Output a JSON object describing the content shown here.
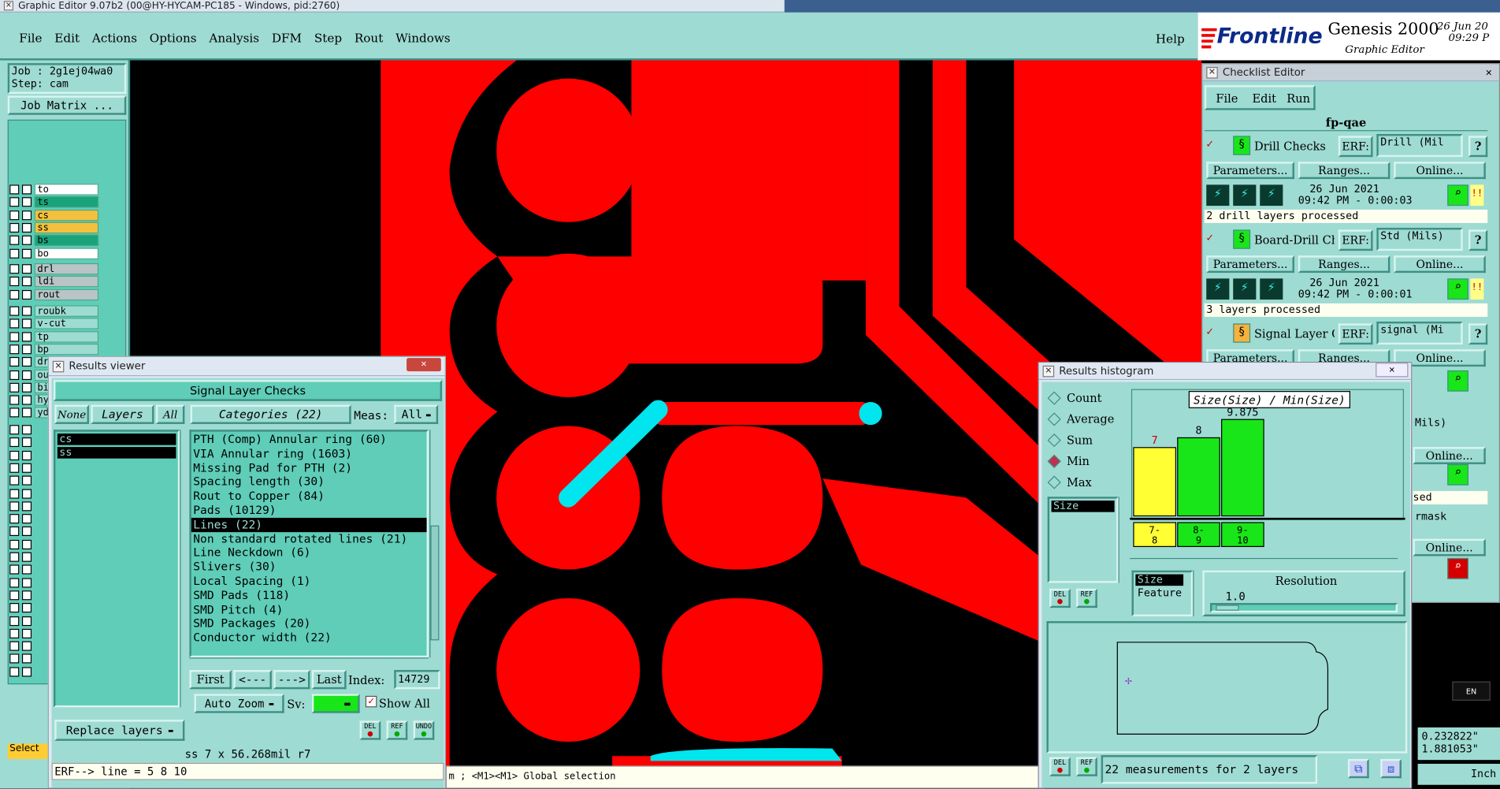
{
  "window": {
    "title": "Graphic Editor 9.07b2 (00@HY-HYCAM-PC185 - Windows, pid:2760)"
  },
  "menu": [
    "File",
    "Edit",
    "Actions",
    "Options",
    "Analysis",
    "DFM",
    "Step",
    "Rout",
    "Windows"
  ],
  "help": "Help",
  "brand": {
    "logo": "Frontline",
    "product": "Genesis 2000",
    "subtitle": "Graphic Editor",
    "date": "26 Jun 20",
    "time": "09:29 P"
  },
  "job": {
    "job": "Job : 2g1ej04wa0",
    "step": "Step: cam",
    "matrix": "Job Matrix ..."
  },
  "layers": {
    "group1": [
      "to",
      "ts",
      "cs",
      "ss",
      "bs",
      "bo"
    ],
    "group2": [
      "drl",
      "ldi",
      "rout"
    ],
    "group3": [
      "roubk",
      "v-cut",
      "tp",
      "bp",
      "drill",
      "outline",
      "biaozhu",
      "hydd",
      "ydkdrl"
    ]
  },
  "colors": {
    "teal": "#9edbd3",
    "dark_teal": "#5fcdb8",
    "copper": "#ff0000",
    "highlight": "#00e5ee",
    "yellow": "#ffff33",
    "green": "#19e619"
  },
  "select_label": "Select",
  "results_viewer": {
    "title": "Results viewer",
    "header": "Signal Layer Checks",
    "none": "None",
    "layers": "Layers",
    "all": "All",
    "categories_btn": "Categories (22)",
    "meas_label": "Meas:",
    "meas_value": "All",
    "layer_list": [
      "cs",
      "ss"
    ],
    "categories": [
      "PTH (Comp) Annular ring (60)",
      "VIA Annular ring (1603)",
      "Missing Pad for PTH (2)",
      "Spacing length (30)",
      "Rout to Copper (84)",
      "Pads (10129)",
      "Lines (22)",
      "Non standard rotated lines (21)",
      "Line Neckdown (6)",
      "Slivers (30)",
      "Local Spacing (1)",
      "SMD Pads (118)",
      "SMD Pitch (4)",
      "SMD Packages (20)",
      "Conductor width (22)"
    ],
    "selected": "Lines (22)",
    "nav": {
      "first": "First",
      "prev": "<---",
      "next": "--->",
      "last": "Last",
      "index_label": "Index:",
      "index_value": "14729"
    },
    "auto_zoom": "Auto Zoom",
    "sv": "Sv:",
    "show_all": "Show All",
    "replace_layers": "Replace layers",
    "icons": [
      "DEL",
      "REF",
      "UNDO"
    ],
    "status": "ss 7 x 56.268mil r7",
    "erf": "ERF--> line = 5 8 10"
  },
  "status_bar": "m ; <M1><M1> Global selection",
  "checklist": {
    "title": "Checklist Editor",
    "menu": [
      "File",
      "Edit",
      "Run"
    ],
    "name": "fp-qae",
    "erf_label": "ERF:",
    "params": "Parameters...",
    "ranges": "Ranges...",
    "online": "Online...",
    "items": [
      {
        "name": "Drill Checks",
        "erf": "Drill (Mil",
        "date": "26 Jun 2021",
        "time": "09:42 PM - 0:00:03",
        "msg": "2 drill layers processed"
      },
      {
        "name": "Board-Drill Che",
        "erf": "Std (Mils)",
        "date": "26 Jun 2021",
        "time": "09:42 PM - 0:00:01",
        "msg": "3 layers processed"
      },
      {
        "name": "Signal Layer Ch",
        "erf": "signal (Mi"
      }
    ],
    "partial": [
      "Mils)",
      "Online...",
      "sed",
      "rmask",
      "Online..."
    ]
  },
  "histogram": {
    "title": "Results histogram",
    "options": [
      "Count",
      "Average",
      "Sum",
      "Min",
      "Max"
    ],
    "selected": "Min",
    "list": [
      "Size"
    ],
    "chart_title": "Size(Size) / Min(Size)",
    "bars": [
      {
        "label": "7-8",
        "value": 7
      },
      {
        "label": "8-9",
        "value": 8
      },
      {
        "label": "9-10",
        "value": 9.875
      }
    ],
    "bar_labels": [
      "7",
      "8",
      "9.875"
    ],
    "size": "Size",
    "feature": "Feature",
    "resolution_label": "Resolution",
    "resolution_value": "1.0",
    "summary": "22 measurements for 2 layers",
    "icons": [
      "DEL",
      "REF"
    ]
  },
  "tray": {
    "lang": "EN",
    "x": "0.232822\"",
    "y": "1.881053\"",
    "unit": "Inch"
  }
}
